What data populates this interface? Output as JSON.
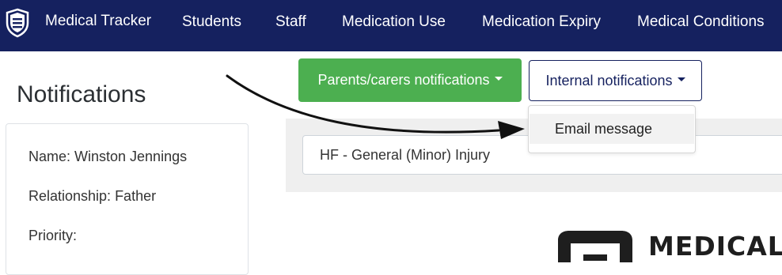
{
  "navbar": {
    "brand": "Medical Tracker",
    "items": [
      {
        "label": "Students"
      },
      {
        "label": "Staff"
      },
      {
        "label": "Medication Use"
      },
      {
        "label": "Medication Expiry"
      },
      {
        "label": "Medical Conditions"
      }
    ],
    "background": "#15215f"
  },
  "page": {
    "title": "Notifications"
  },
  "contact": {
    "name": "Name: Winston Jennings",
    "relationship": "Relationship: Father",
    "priority": "Priority:"
  },
  "buttons": {
    "parents": "Parents/carers notifications",
    "internal": "Internal notifications"
  },
  "dropdown": {
    "items": [
      {
        "label": "Email message"
      }
    ]
  },
  "template_select": {
    "value": "HF - General (Minor) Injury"
  },
  "brand_watermark": {
    "text": "MEDICAL"
  },
  "colors": {
    "accent_green": "#4caf50",
    "navy": "#15215f"
  },
  "icons": [
    "shield-icon",
    "caret-down-icon",
    "arrow-annotation"
  ]
}
